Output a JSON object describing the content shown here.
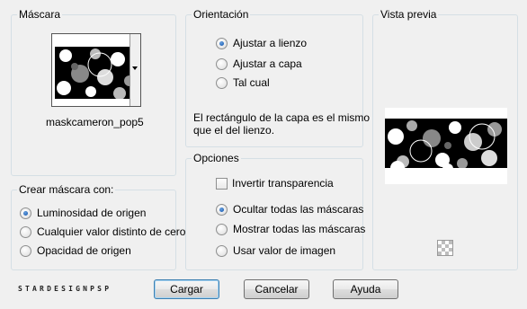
{
  "mask": {
    "title": "Máscara",
    "name": "maskcameron_pop5"
  },
  "create": {
    "title": "Crear máscara con:",
    "options": [
      "Luminosidad de origen",
      "Cualquier valor distinto de cero",
      "Opacidad de origen"
    ],
    "selected": 0
  },
  "orientation": {
    "title": "Orientación",
    "options": [
      "Ajustar a lienzo",
      "Ajustar a capa",
      "Tal cual"
    ],
    "selected": 0,
    "note_line1": "El rectángulo de la capa es el mismo",
    "note_line2": "que el del lienzo."
  },
  "options": {
    "title": "Opciones",
    "invert_label": "Invertir transparencia",
    "invert_checked": false,
    "radios": [
      "Ocultar todas las máscaras",
      "Mostrar todas las máscaras",
      "Usar valor de imagen"
    ],
    "selected": 0
  },
  "preview": {
    "title": "Vista previa"
  },
  "footer": {
    "brand": "STARDESIGNPSP",
    "load": "Cargar",
    "cancel": "Cancelar",
    "help": "Ayuda"
  },
  "icons": {
    "dropdown": "chevron-down-icon",
    "transparency": "checkerboard-icon"
  }
}
